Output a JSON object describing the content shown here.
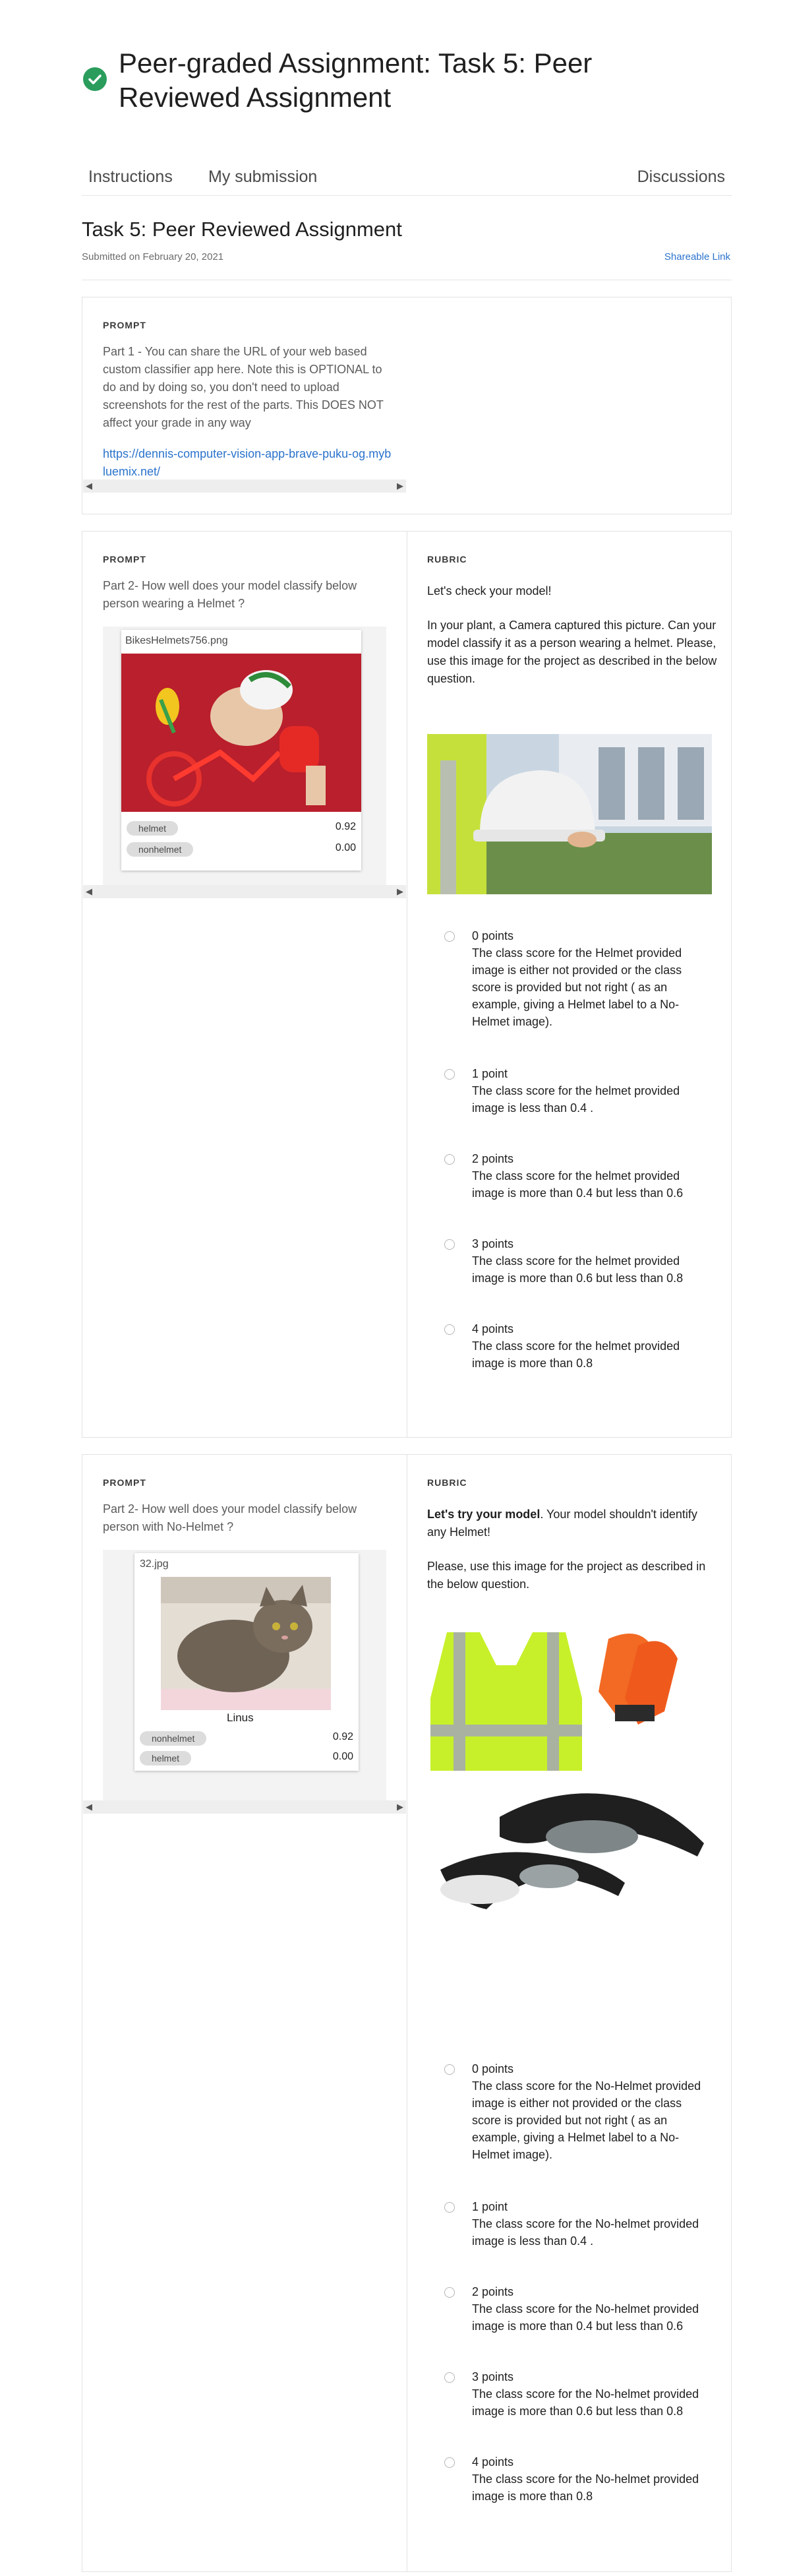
{
  "header": {
    "title": "Peer-graded Assignment: Task 5: Peer Reviewed Assignment",
    "check_icon": "check-circle-icon",
    "accent": "#2a9d5c"
  },
  "nav": {
    "instructions": "Instructions",
    "my_submission": "My submission",
    "discussions": "Discussions"
  },
  "submission": {
    "title": "Task 5: Peer Reviewed Assignment",
    "submitted": "Submitted on February 20, 2021",
    "share": "Shareable Link"
  },
  "part1": {
    "prompt_label": "PROMPT",
    "prompt": "Part 1 - You can share the URL of your web based custom classifier app here. Note this is OPTIONAL to do and by doing so, you don't need to upload screenshots for the rest of the parts. This DOES NOT affect your grade in any way",
    "url": "https://dennis-computer-vision-app-brave-puku-og.mybluemix.net/"
  },
  "part2": {
    "prompt_label": "PROMPT",
    "prompt": "Part 2- How well does your model classify below person wearing a Helmet ?",
    "filename": "BikesHelmets756.png",
    "results": [
      {
        "label": "helmet",
        "score": "0.92"
      },
      {
        "label": "nonhelmet",
        "score": "0.00"
      }
    ],
    "rubric_label": "RUBRIC",
    "intro": "Let's check your model!",
    "body": "In your plant, a Camera captured this picture. Can your model classify it as a person wearing a helmet. Please, use this image for the project as described in the below question.",
    "options": [
      {
        "points": "0 points",
        "desc": "The class score for the Helmet provided image is either not provided or the class score is provided but not right ( as an example, giving a Helmet label to a No-Helmet image)."
      },
      {
        "points": "1 point",
        "desc": "The class score for the helmet provided image is less than 0.4 ."
      },
      {
        "points": "2 points",
        "desc": "The class score for the helmet provided image is more than 0.4 but less than 0.6"
      },
      {
        "points": "3 points",
        "desc": "The class score for the helmet provided image is more than 0.6 but less than 0.8"
      },
      {
        "points": "4 points",
        "desc": "The class score for the helmet provided image is more than 0.8"
      }
    ]
  },
  "part3": {
    "prompt_label": "PROMPT",
    "prompt": "Part 2- How well does your model classify below person with No-Helmet ?",
    "filename": "32.jpg",
    "caption": "Linus",
    "results": [
      {
        "label": "nonhelmet",
        "score": "0.92"
      },
      {
        "label": "helmet",
        "score": "0.00"
      }
    ],
    "rubric_label": "RUBRIC",
    "intro_bold": "Let's try your model",
    "intro_rest": ". Your model shouldn't identify any Helmet!",
    "body": "Please, use this image for the project as described in the below question.",
    "options": [
      {
        "points": "0 points",
        "desc": "The class score for the No-Helmet provided image is either not provided or the class score is provided but not right ( as an example, giving a Helmet label to a No-Helmet image)."
      },
      {
        "points": "1 point",
        "desc": "The class score for the No-helmet provided image is less than 0.4 ."
      },
      {
        "points": "2 points",
        "desc": "The class score for the No-helmet provided image is more than 0.4 but less than 0.6"
      },
      {
        "points": "3 points",
        "desc": "The class score for the No-helmet provided image is more than 0.6 but less than 0.8"
      },
      {
        "points": "4 points",
        "desc": "The class score for the No-helmet provided image is more than 0.8"
      }
    ]
  }
}
